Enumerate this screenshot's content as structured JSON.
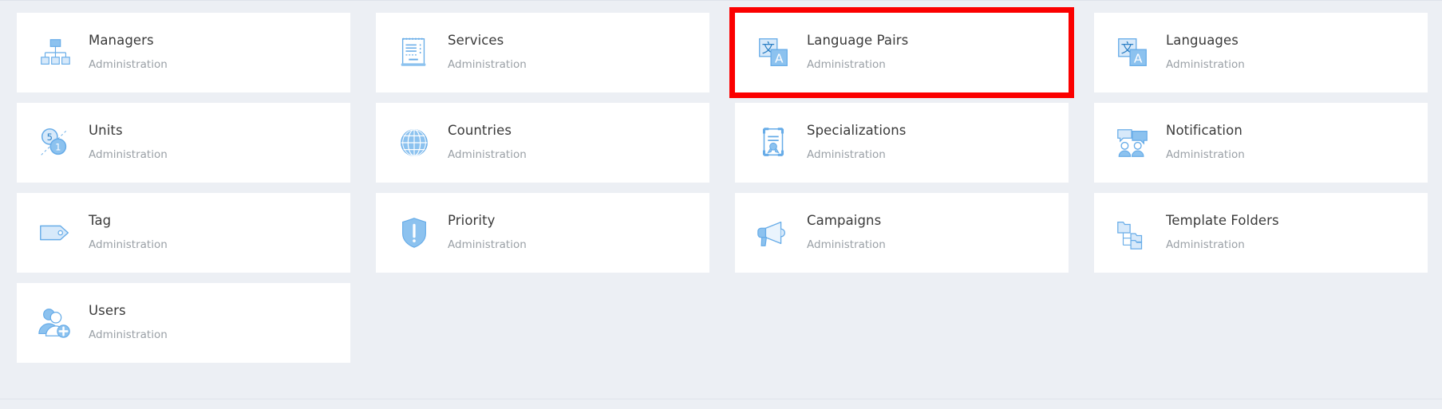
{
  "page": {
    "background_color": "#eceff4",
    "card_color": "#ffffff",
    "title_color": "#3a3a3a",
    "subtitle_color": "#9aa0a6",
    "highlight_color": "#fb0000",
    "icon_accent": "#67ace8",
    "icon_fill_light": "#d7e9fa"
  },
  "tiles": [
    {
      "title": "Managers",
      "subtitle": "Administration",
      "icon": "org-chart-icon",
      "highlighted": false
    },
    {
      "title": "Services",
      "subtitle": "Administration",
      "icon": "document-list-icon",
      "highlighted": false
    },
    {
      "title": "Language Pairs",
      "subtitle": "Administration",
      "icon": "translate-pair-icon",
      "highlighted": true
    },
    {
      "title": "Languages",
      "subtitle": "Administration",
      "icon": "translate-icon",
      "highlighted": false
    },
    {
      "title": "Units",
      "subtitle": "Administration",
      "icon": "units-ratio-icon",
      "highlighted": false
    },
    {
      "title": "Countries",
      "subtitle": "Administration",
      "icon": "globe-icon",
      "highlighted": false
    },
    {
      "title": "Specializations",
      "subtitle": "Administration",
      "icon": "certificate-icon",
      "highlighted": false
    },
    {
      "title": "Notification",
      "subtitle": "Administration",
      "icon": "people-chat-icon",
      "highlighted": false
    },
    {
      "title": "Tag",
      "subtitle": "Administration",
      "icon": "tag-icon",
      "highlighted": false
    },
    {
      "title": "Priority",
      "subtitle": "Administration",
      "icon": "shield-alert-icon",
      "highlighted": false
    },
    {
      "title": "Campaigns",
      "subtitle": "Administration",
      "icon": "megaphone-icon",
      "highlighted": false
    },
    {
      "title": "Template Folders",
      "subtitle": "Administration",
      "icon": "folder-tree-icon",
      "highlighted": false
    },
    {
      "title": "Users",
      "subtitle": "Administration",
      "icon": "add-user-icon",
      "highlighted": false
    }
  ],
  "icon_labels": {
    "units_badge_top": "5",
    "units_badge_bottom": "1",
    "translate_glyph": "文",
    "translate_letter": "A"
  }
}
